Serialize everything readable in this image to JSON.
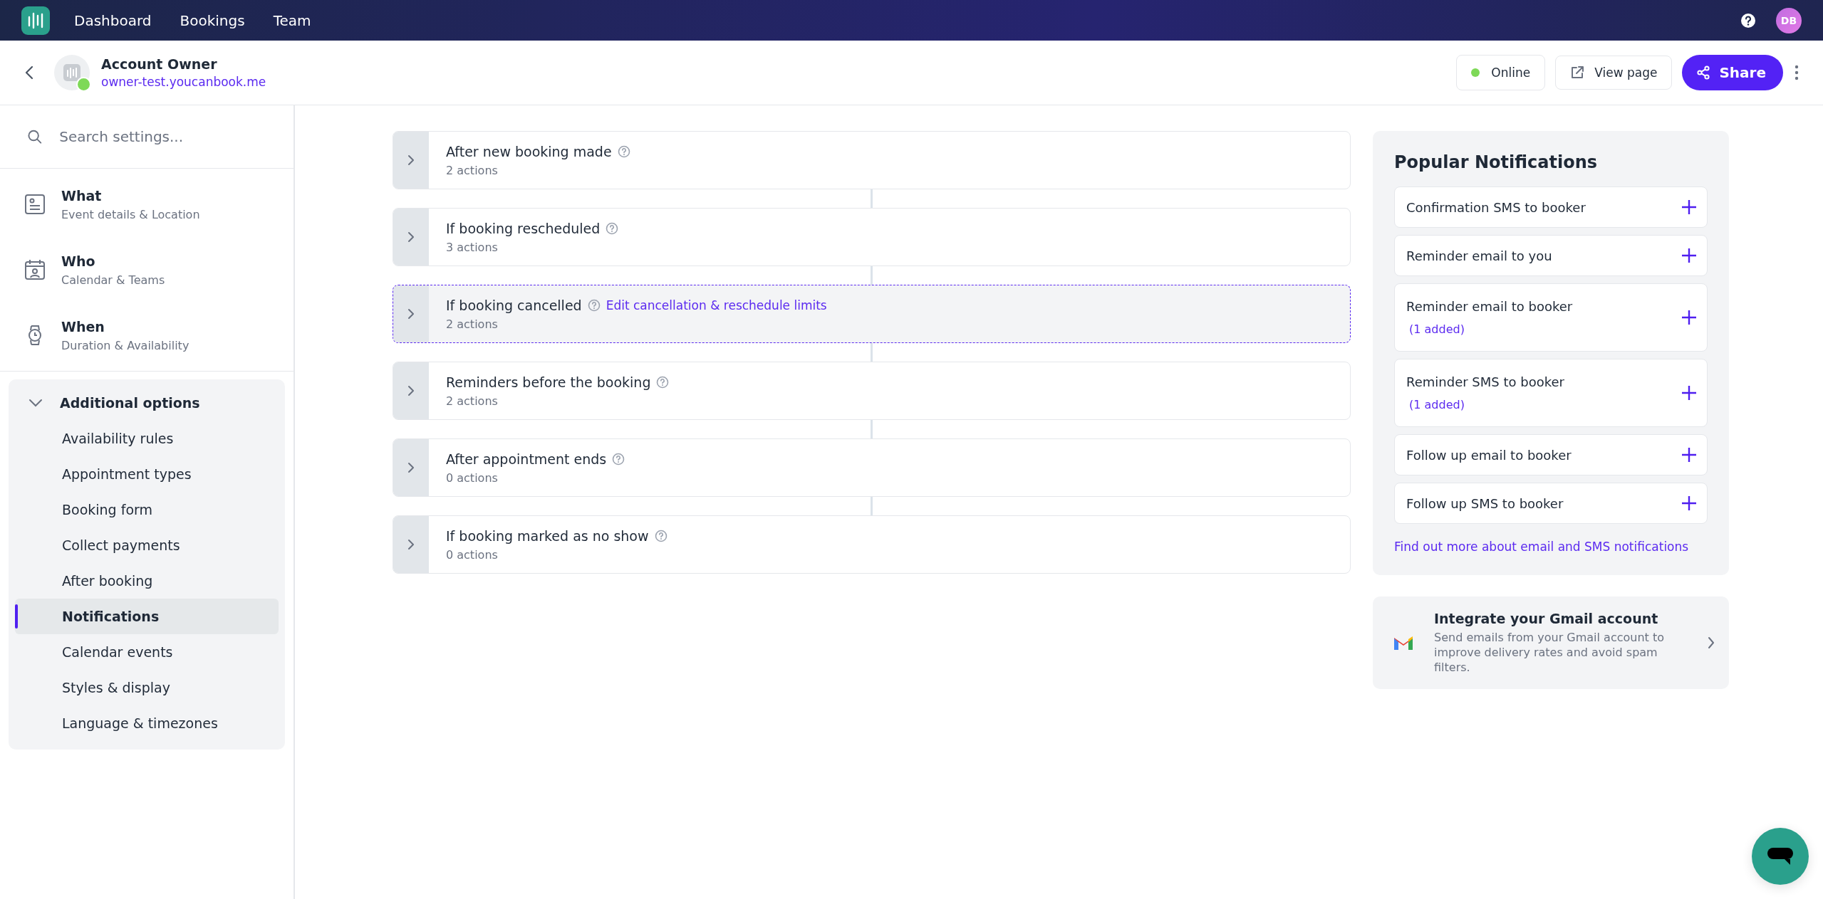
{
  "top_nav": {
    "items": [
      {
        "label": "Dashboard",
        "selected": false
      },
      {
        "label": "Bookings",
        "selected": false
      },
      {
        "label": "Team",
        "selected": false
      }
    ],
    "avatar": "DB"
  },
  "header": {
    "title": "Account Owner",
    "url": "owner-test.youcanbook.me",
    "status": {
      "label": "Online",
      "online": true
    },
    "view_page": "View page",
    "share": "Share"
  },
  "sidebar": {
    "search": {
      "placeholder": "Search settings..."
    },
    "sections": [
      {
        "kind": "document",
        "title": "What",
        "subtitle": "Event details & Location"
      },
      {
        "kind": "calendar",
        "title": "Who",
        "subtitle": "Calendar & Teams"
      },
      {
        "kind": "watch",
        "title": "When",
        "subtitle": "Duration & Availability"
      }
    ],
    "additional": {
      "title": "Additional options",
      "expanded": true,
      "items": [
        {
          "label": "Availability rules",
          "selected": false
        },
        {
          "label": "Appointment types",
          "selected": false
        },
        {
          "label": "Booking form",
          "selected": false
        },
        {
          "label": "Collect payments",
          "selected": false
        },
        {
          "label": "After booking",
          "selected": false
        },
        {
          "label": "Notifications",
          "selected": true
        },
        {
          "label": "Calendar events",
          "selected": false
        },
        {
          "label": "Styles & display",
          "selected": false
        },
        {
          "label": "Language & timezones",
          "selected": false
        }
      ]
    }
  },
  "triggers": [
    {
      "title": "After new booking made",
      "actions": "2 actions",
      "highlighted": false
    },
    {
      "title": "If booking rescheduled",
      "actions": "3 actions",
      "highlighted": false
    },
    {
      "title": "If booking cancelled",
      "link": "Edit cancellation & reschedule limits",
      "actions": "2 actions",
      "highlighted": true
    },
    {
      "title": "Reminders before the booking",
      "actions": "2 actions",
      "highlighted": false
    },
    {
      "title": "After appointment ends",
      "actions": "0 actions",
      "highlighted": false
    },
    {
      "title": "If booking marked as no show",
      "actions": "0 actions",
      "highlighted": false
    }
  ],
  "popular": {
    "title": "Popular Notifications",
    "items": [
      {
        "label": "Confirmation SMS to booker"
      },
      {
        "label": "Reminder email to you"
      },
      {
        "label": "Reminder email to booker",
        "added": "(1 added)"
      },
      {
        "label": "Reminder SMS to booker",
        "added": "(1 added)"
      },
      {
        "label": "Follow up email to booker"
      },
      {
        "label": "Follow up SMS to booker"
      }
    ],
    "link": "Find out more about email and SMS notifications"
  },
  "gmail": {
    "title": "Integrate your Gmail account",
    "description": "Send emails from your Gmail account to improve delivery rates and avoid spam filters."
  }
}
